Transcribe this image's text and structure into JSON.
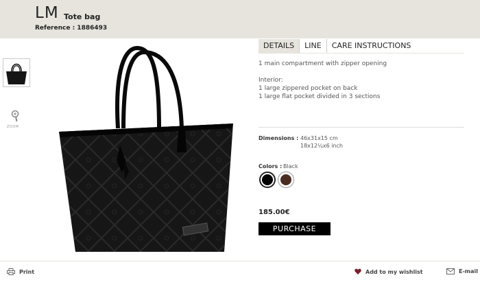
{
  "header": {
    "brand": "LM",
    "product_type": "Tote bag",
    "reference": "Reference : 1886493"
  },
  "gallery": {
    "zoom_label": "ZOOM",
    "icons": [
      "bag-thumbnail",
      "zoom-icon"
    ]
  },
  "tabs": [
    {
      "label": "DETAILS",
      "active": true
    },
    {
      "label": "LINE",
      "active": false
    },
    {
      "label": "CARE INSTRUCTIONS",
      "active": false
    }
  ],
  "details": {
    "line1": "1 main compartment with zipper opening",
    "interior_heading": "Interior:",
    "interior_1": "1 large zippered pocket on back",
    "interior_2": "1 large flat pocket divided in 3 sections"
  },
  "dimensions": {
    "label": "Dimensions :",
    "metric": "46x31x15 cm",
    "imperial": "18x12¼x6 inch"
  },
  "colors": {
    "label": "Colors :",
    "selected": "Black",
    "swatches": [
      {
        "name": "black",
        "hex": "#000000",
        "selected": true
      },
      {
        "name": "brown",
        "hex": "#4a2c20",
        "selected": false
      }
    ]
  },
  "purchase": {
    "price": "185.00€",
    "button_label": "PURCHASE"
  },
  "footer": {
    "print": "Print",
    "wishlist": "Add to my wishlist",
    "email": "E-mail"
  },
  "theme": {
    "header_bg": "#e6e4dd",
    "accent": "#000000",
    "wishlist_heart": "#7a1f2b"
  }
}
